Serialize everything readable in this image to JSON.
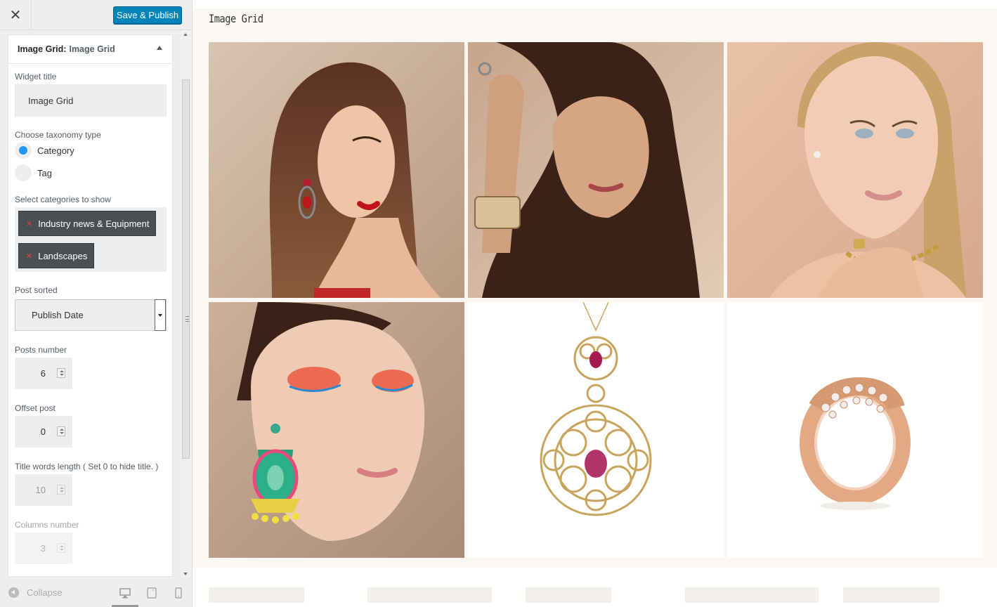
{
  "header": {
    "close_label": "✕",
    "save_label": "Save & Publish"
  },
  "widget": {
    "title_main": "Image Grid:",
    "title_sub": "Image Grid",
    "widget_title_label": "Widget title",
    "widget_title_value": "Image Grid",
    "taxonomy_label": "Choose taxonomy type",
    "taxonomy_options": [
      "Category",
      "Tag"
    ],
    "taxonomy_selected": "Category",
    "categories_label": "Select categories to show",
    "categories": [
      "Industry news & Equipment",
      "Landscapes"
    ],
    "sorted_label": "Post sorted",
    "sorted_value": "Publish Date",
    "posts_number_label": "Posts number",
    "posts_number": "6",
    "offset_label": "Offset post",
    "offset": "0",
    "title_words_label": "Title words length ( Set 0 to hide title. )",
    "title_words": "10",
    "columns_label": "Columns number",
    "columns": "3"
  },
  "footer": {
    "collapse_label": "Collapse"
  },
  "preview": {
    "grid_title": "Image Grid",
    "images": [
      "woman-red-earring",
      "woman-dark-hair-bracelet",
      "blonde-woman-necklace",
      "woman-colorful-makeup",
      "gold-filigree-pendant",
      "rose-gold-diamond-ring"
    ]
  },
  "colors": {
    "accent": "#0085ba",
    "radio": "#2196f3",
    "tag_bg": "#4a4f54",
    "tag_x": "#e04040"
  }
}
